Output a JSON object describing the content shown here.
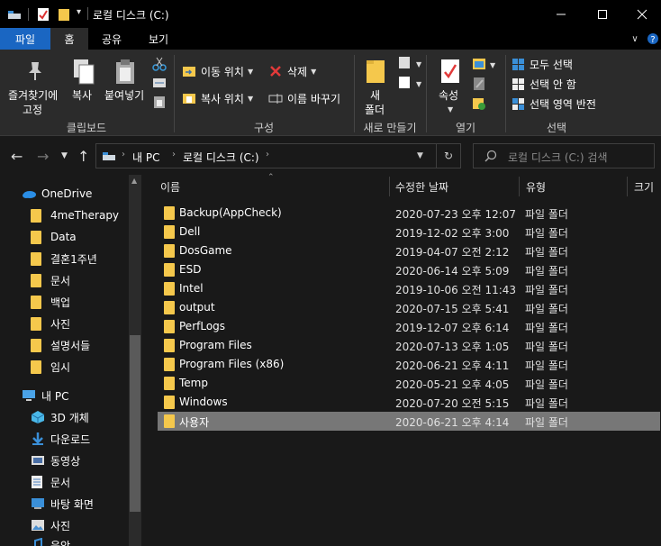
{
  "window": {
    "title": "로컬 디스크 (C:)"
  },
  "ribbon_tabs": [
    "파일",
    "홈",
    "공유",
    "보기"
  ],
  "ribbon": {
    "clipboard": {
      "pin_label_line1": "즐겨찾기에",
      "pin_label_line2": "고정",
      "copy_label": "복사",
      "paste_label": "붙여넣기",
      "group_title": "클립보드"
    },
    "organize": {
      "move_label": "이동 위치",
      "copy_to_label": "복사 위치",
      "delete_label": "삭제",
      "rename_label": "이름 바꾸기",
      "group_title": "구성"
    },
    "new": {
      "new_folder_line1": "새",
      "new_folder_line2": "폴더",
      "group_title": "새로 만들기"
    },
    "open": {
      "properties_label": "속성",
      "group_title": "열기"
    },
    "select": {
      "select_all": "모두 선택",
      "select_none": "선택 안 함",
      "invert": "선택 영역 반전",
      "group_title": "선택"
    }
  },
  "address": {
    "crumbs": [
      "내 PC",
      "로컬 디스크 (C:)"
    ],
    "search_placeholder": "로컬 디스크 (C:) 검색"
  },
  "nav": {
    "items": [
      {
        "label": "OneDrive",
        "icon": "onedrive-icon"
      },
      {
        "label": "4meTherapy",
        "icon": "folder-icon"
      },
      {
        "label": "Data",
        "icon": "folder-icon"
      },
      {
        "label": "결혼1주년",
        "icon": "folder-icon"
      },
      {
        "label": "문서",
        "icon": "folder-icon"
      },
      {
        "label": "백업",
        "icon": "folder-icon"
      },
      {
        "label": "사진",
        "icon": "folder-icon"
      },
      {
        "label": "설명서들",
        "icon": "folder-icon"
      },
      {
        "label": "임시",
        "icon": "folder-icon"
      },
      {
        "label": "내 PC",
        "icon": "pc-icon"
      },
      {
        "label": "3D 개체",
        "icon": "cube-icon"
      },
      {
        "label": "다운로드",
        "icon": "download-icon"
      },
      {
        "label": "동영상",
        "icon": "video-icon"
      },
      {
        "label": "문서",
        "icon": "document-icon"
      },
      {
        "label": "바탕 화면",
        "icon": "desktop-icon"
      },
      {
        "label": "사진",
        "icon": "picture-icon"
      },
      {
        "label": "음악",
        "icon": "music-icon"
      }
    ]
  },
  "columns": [
    "이름",
    "수정한 날짜",
    "유형",
    "크기"
  ],
  "files": [
    {
      "name": "Backup(AppCheck)",
      "date": "2020-07-23 오후 12:07",
      "type": "파일 폴더"
    },
    {
      "name": "Dell",
      "date": "2019-12-02 오후 3:00",
      "type": "파일 폴더"
    },
    {
      "name": "DosGame",
      "date": "2019-04-07 오전 2:12",
      "type": "파일 폴더"
    },
    {
      "name": "ESD",
      "date": "2020-06-14 오후 5:09",
      "type": "파일 폴더"
    },
    {
      "name": "Intel",
      "date": "2019-10-06 오전 11:43",
      "type": "파일 폴더"
    },
    {
      "name": "output",
      "date": "2020-07-15 오후 5:41",
      "type": "파일 폴더"
    },
    {
      "name": "PerfLogs",
      "date": "2019-12-07 오후 6:14",
      "type": "파일 폴더"
    },
    {
      "name": "Program Files",
      "date": "2020-07-13 오후 1:05",
      "type": "파일 폴더"
    },
    {
      "name": "Program Files (x86)",
      "date": "2020-06-21 오후 4:11",
      "type": "파일 폴더"
    },
    {
      "name": "Temp",
      "date": "2020-05-21 오후 4:05",
      "type": "파일 폴더"
    },
    {
      "name": "Windows",
      "date": "2020-07-20 오전 5:15",
      "type": "파일 폴더"
    },
    {
      "name": "사용자",
      "date": "2020-06-21 오후 4:14",
      "type": "파일 폴더",
      "selected": true
    }
  ],
  "colors": {
    "accent": "#1a66c2",
    "folder": "#f5c84c",
    "selection": "#777777"
  }
}
